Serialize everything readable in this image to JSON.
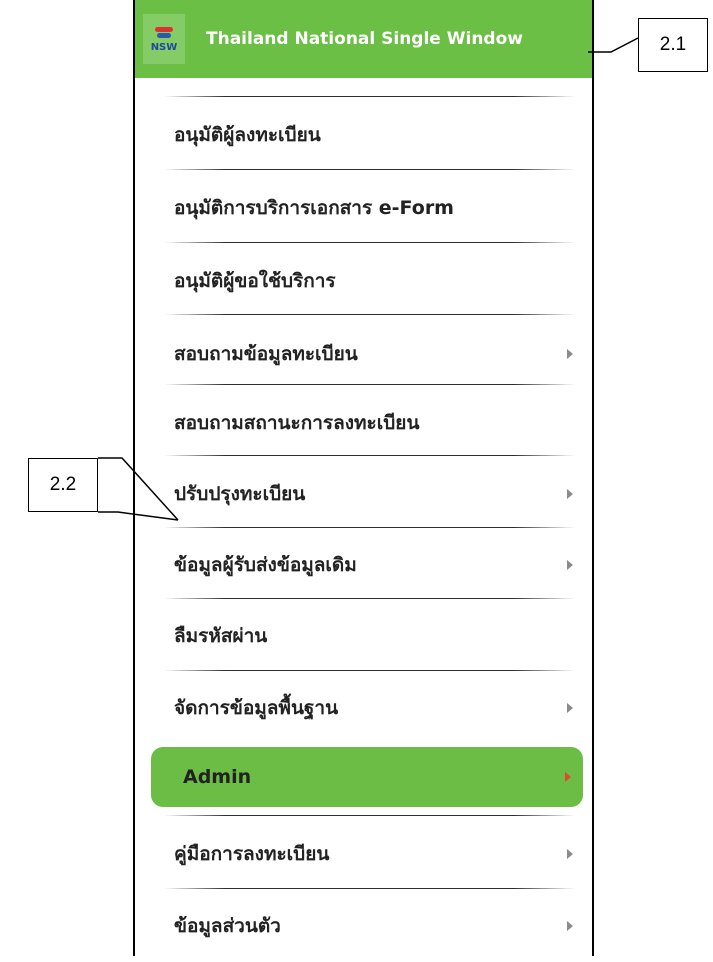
{
  "header": {
    "logo_text": "NSW",
    "title": "Thailand National Single Window"
  },
  "menu": {
    "items": [
      {
        "label": "อนุมัติผู้ลงทะเบียน",
        "has_submenu": false,
        "active": false
      },
      {
        "label": "อนุมัติการบริการเอกสาร e-Form",
        "has_submenu": false,
        "active": false
      },
      {
        "label": "อนุมัติผู้ขอใช้บริการ",
        "has_submenu": false,
        "active": false
      },
      {
        "label": "สอบถามข้อมูลทะเบียน",
        "has_submenu": true,
        "active": false
      },
      {
        "label": "สอบถามสถานะการลงทะเบียน",
        "has_submenu": false,
        "active": false
      },
      {
        "label": "ปรับปรุงทะเบียน",
        "has_submenu": true,
        "active": false
      },
      {
        "label": "ข้อมูลผู้รับส่งข้อมูลเดิม",
        "has_submenu": true,
        "active": false
      },
      {
        "label": "ลืมรหัสผ่าน",
        "has_submenu": false,
        "active": false
      },
      {
        "label": "จัดการข้อมูลพื้นฐาน",
        "has_submenu": true,
        "active": false
      },
      {
        "label": "Admin",
        "has_submenu": true,
        "active": true
      },
      {
        "label": "คู่มือการลงทะเบียน",
        "has_submenu": true,
        "active": false
      },
      {
        "label": "ข้อมูลส่วนตัว",
        "has_submenu": true,
        "active": false
      }
    ]
  },
  "callouts": {
    "header": "2.1",
    "menu": "2.2"
  },
  "colors": {
    "header_bg": "#6cbf45",
    "active_bg": "#6bbd46",
    "active_arrow": "#e8452c",
    "arrow": "#8a8a8a"
  },
  "icons": {
    "logo": "nsw-logo-icon",
    "submenu": "chevron-right-icon"
  }
}
